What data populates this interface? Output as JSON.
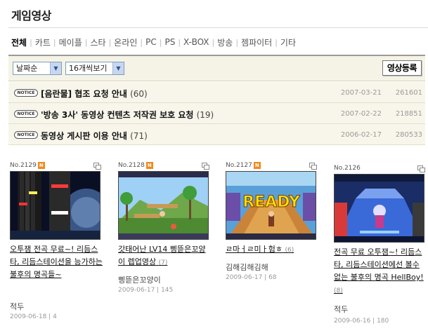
{
  "page_title": "게임영상",
  "categories": [
    "전체",
    "카트",
    "메이플",
    "스타",
    "온라인",
    "PC",
    "PS",
    "X-BOX",
    "방송",
    "젬파이터",
    "기타"
  ],
  "filters": {
    "sort": "날짜순",
    "per_page": "16개씩보기",
    "register_button": "영상등록"
  },
  "notices": [
    {
      "badge": "NOTICE",
      "title": "[음란물] 협조 요청 안내",
      "count": "(60)",
      "date": "2007-03-21",
      "views": "261601"
    },
    {
      "badge": "NOTICE",
      "title": "'방송 3사' 동영상 컨텐츠 저작권 보호 요청",
      "count": "(19)",
      "date": "2007-02-22",
      "views": "218851"
    },
    {
      "badge": "NOTICE",
      "title": "동영상 게시판 이용 안내",
      "count": "(71)",
      "date": "2006-02-17",
      "views": "280533"
    }
  ],
  "videos": [
    {
      "no": "No.2129",
      "new_badge": "N",
      "title": "오투잼 전곡 무료~! 리듬스타, 리듬스테이션을 능가하는 불후의 명곡들~",
      "count": "",
      "author": "적두",
      "date": "2009-06-18",
      "views": "4"
    },
    {
      "no": "No.2128",
      "new_badge": "N",
      "title": "갓태어난 LV14 삥뜯은꼬양이 렙업영상",
      "count": "(7)",
      "author": "삥뜯은꼬양이",
      "date": "2009-06-17",
      "views": "145"
    },
    {
      "no": "No.2127",
      "new_badge": "N",
      "title": "ㄹ마ㅓㄹ미ㅏ험ㅎ",
      "count": "(6)",
      "author": "김해김해김해",
      "date": "2009-06-17",
      "views": "68"
    },
    {
      "no": "No.2126",
      "new_badge": "",
      "title": "전곡 무료 오투잼~! 리듬스타, 리듬스테이션에선 볼수 없는 불후의 명곡 HellBoy!",
      "count": "(8)",
      "author": "적두",
      "date": "2009-06-16",
      "views": "180"
    }
  ],
  "thumbnail_text": {
    "ready": "READY"
  },
  "colors": {
    "new_badge": "#f08a1c",
    "notice_bg": "#f8f6eb",
    "filter_bg": "#f5f3e6"
  }
}
